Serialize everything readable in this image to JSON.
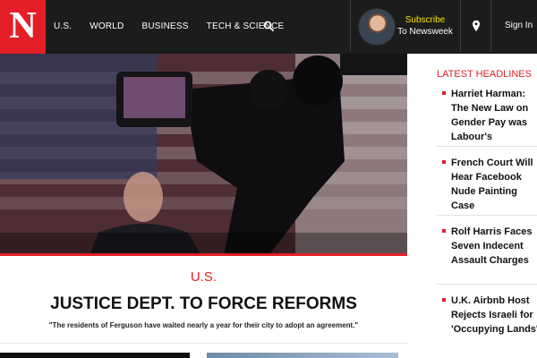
{
  "brand": {
    "logo_letter": "N",
    "accent": "#e41e26",
    "header_bg": "#1c1c1c"
  },
  "nav": {
    "items": [
      "U.S.",
      "WORLD",
      "BUSINESS",
      "TECH & SCIENCE"
    ],
    "search_icon": "search-icon"
  },
  "account": {
    "subscribe_label": "Subscribe",
    "subscribe_sub": "To Newsweek",
    "location_icon": "location-pin-icon",
    "signin_label": "Sign In"
  },
  "hero": {
    "section": "U.S.",
    "headline": "JUSTICE DEPT. TO FORCE REFORMS",
    "dek": "\"The residents of Ferguson have waited nearly a year for their city to adopt an agreement.\""
  },
  "sidebar": {
    "title": "LATEST HEADLINES",
    "headlines": [
      "Harriet Harman: The New Law on Gender Pay was Labour's",
      "French Court Will Hear Facebook Nude Painting Case",
      "Rolf Harris Faces Seven Indecent Assault Charges",
      "U.K. Airbnb Host Rejects Israeli for 'Occupying Lands'"
    ]
  }
}
